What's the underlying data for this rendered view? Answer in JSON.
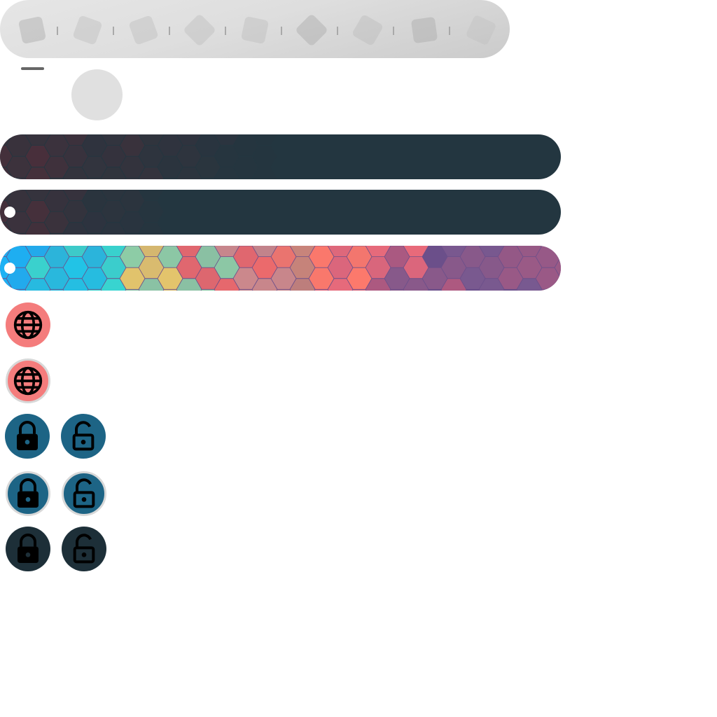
{
  "colors": {
    "toolbar_bg": "#dedede",
    "bar_dark_bg": "#233640",
    "bar_dark_hex": "#5a2d38",
    "globe_btn": "#f47c7c",
    "lock_btn": "#1d6485",
    "lock_btn_dark": "#1d2f38",
    "icon_fg": "#000000",
    "ring": "#d8d8d8"
  },
  "toolbar": {
    "slots": [
      {
        "icon": "placeholder-diamond"
      },
      {
        "icon": "placeholder-diamond"
      },
      {
        "icon": "placeholder-diamond"
      },
      {
        "icon": "placeholder-diamond"
      },
      {
        "icon": "placeholder-diamond"
      },
      {
        "icon": "placeholder-diamond"
      },
      {
        "icon": "placeholder-diamond"
      },
      {
        "icon": "placeholder-diamond"
      },
      {
        "icon": "placeholder-diamond"
      }
    ]
  },
  "bars": [
    {
      "style": "dark-hex",
      "progress": 0.5,
      "knob": false
    },
    {
      "style": "dark-hex",
      "progress": 0.3,
      "knob": true
    },
    {
      "style": "rainbow-hex",
      "progress": 1.0,
      "knob": true
    }
  ],
  "buttons": [
    {
      "icon": "globe-icon",
      "variant": "plain"
    },
    {
      "icon": "globe-icon",
      "variant": "ring"
    },
    {
      "icon": "lock-closed-icon",
      "variant": "plain"
    },
    {
      "icon": "lock-open-icon",
      "variant": "plain"
    },
    {
      "icon": "lock-closed-icon",
      "variant": "ring"
    },
    {
      "icon": "lock-open-icon",
      "variant": "ring"
    },
    {
      "icon": "lock-closed-icon",
      "variant": "dark"
    },
    {
      "icon": "lock-open-icon",
      "variant": "dark"
    }
  ]
}
